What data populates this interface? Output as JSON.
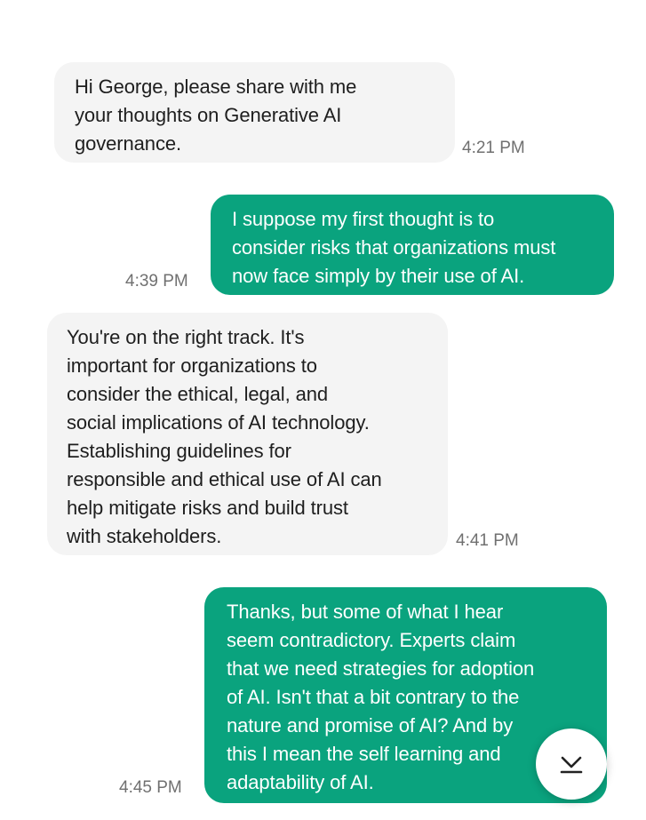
{
  "messages": [
    {
      "direction": "incoming",
      "text": "Hi George, please share with me\nyour thoughts on Generative AI\ngovernance.",
      "time": "4:21 PM"
    },
    {
      "direction": "outgoing",
      "text": "I suppose my first thought is to\nconsider risks that organizations must\nnow face simply by their use of AI.",
      "time": "4:39 PM"
    },
    {
      "direction": "incoming",
      "text": "You're on the right track. It's\nimportant for organizations to\nconsider the ethical, legal, and\nsocial implications of AI technology.\nEstablishing guidelines for\nresponsible and ethical use of AI can\nhelp mitigate risks and build trust\nwith stakeholders.",
      "time": "4:41 PM"
    },
    {
      "direction": "outgoing",
      "text": "Thanks, but some of what I hear\nseem contradictory. Experts claim\nthat we need strategies for adoption\nof AI. Isn't that a bit contrary to the\nnature and promise of AI? And by\nthis I mean the self learning and\nadaptability of AI.",
      "time": "4:45 PM"
    }
  ],
  "scroll_button": {
    "icon": "scroll-to-bottom-icon"
  },
  "colors": {
    "outgoing_bubble": "#0aa37e",
    "incoming_bubble": "#f4f4f4",
    "timestamp": "#707070"
  }
}
